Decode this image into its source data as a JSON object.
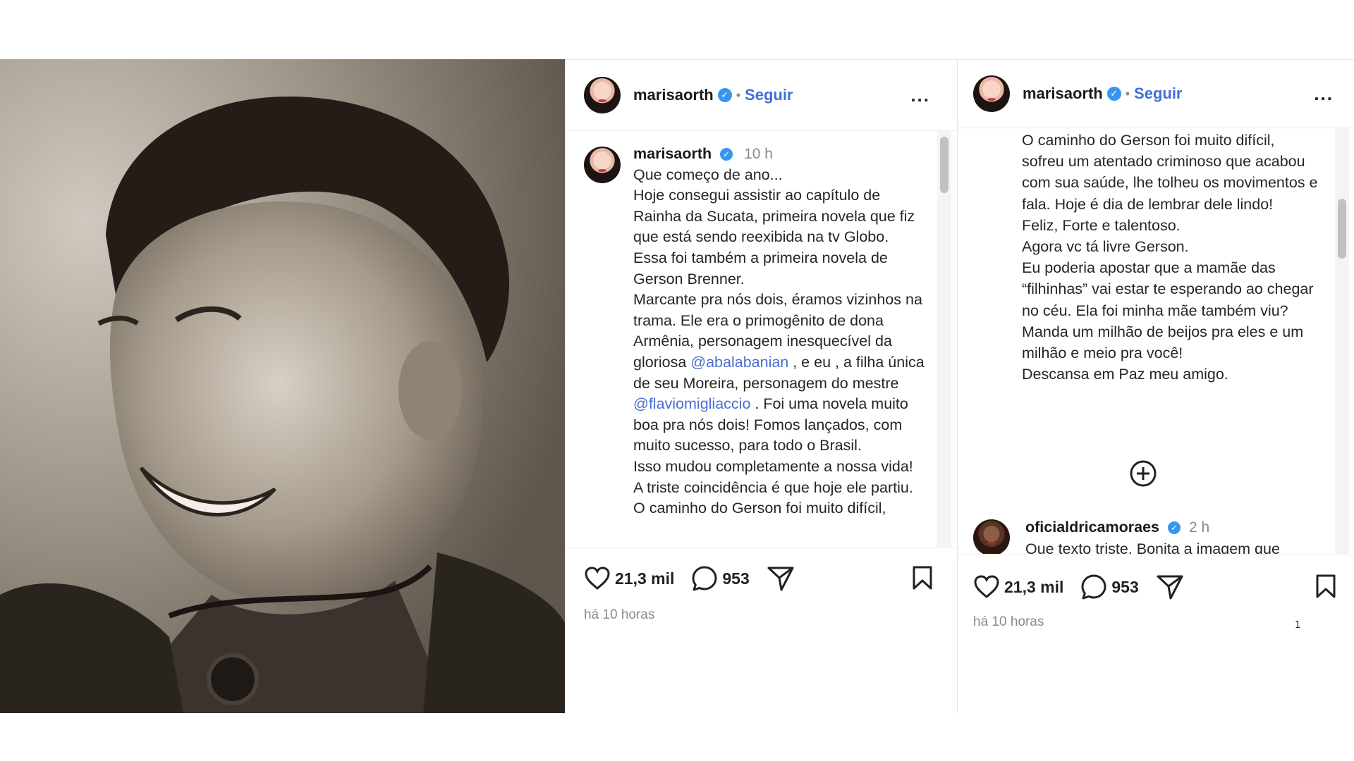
{
  "colors": {
    "link": "#3f6fd8",
    "mention": "#4b6fd0",
    "verified": "#3796f0",
    "muted": "#8a8a8a"
  },
  "panel1": {
    "header": {
      "username": "marisaorth",
      "separator": "•",
      "follow_label": "Seguir",
      "more_icon": "..."
    },
    "caption": {
      "username": "marisaorth",
      "time": "10 h",
      "text_1": "Que começo de ano...\nHoje consegui assistir ao capítulo de Rainha da Sucata, primeira novela que fiz que está sendo reexibida na tv Globo.\nEssa foi também a primeira novela de Gerson Brenner.\nMarcante pra nós dois, éramos vizinhos na trama. Ele era o primogênito de dona Armênia, personagem inesquecível da gloriosa ",
      "mention_1": "@abalabanian",
      "text_2": " , e eu , a filha única de seu Moreira, personagem do mestre ",
      "mention_2": "@flaviomigliaccio",
      "text_3": " . Foi uma novela muito boa pra nós dois! Fomos lançados, com muito sucesso, para todo o Brasil.\nIsso mudou completamente a nossa vida!\nA triste coincidência é que hoje ele partiu.\nO caminho do Gerson foi muito difícil,"
    },
    "actions": {
      "likes": "21,3 mil",
      "comments": "953",
      "timestamp": "há 10 horas"
    }
  },
  "panel2": {
    "header": {
      "username": "marisaorth",
      "separator": "•",
      "follow_label": "Seguir",
      "more_icon": "..."
    },
    "caption_text": "O caminho do Gerson foi muito difícil, sofreu um atentado criminoso que acabou com sua saúde, lhe tolheu os movimentos e fala. Hoje é dia de lembrar dele lindo!\nFeliz, Forte e talentoso.\nAgora vc tá livre Gerson.\nEu poderia apostar que a mamãe das “filhinhas” vai estar te esperando ao chegar no céu. Ela foi minha mãe também viu? Manda um milhão de beijos pra eles e um milhão e meio pra você!\nDescansa  em Paz meu amigo.",
    "comment": {
      "username": "oficialdricamoraes",
      "time": "2 h",
      "text": "Que texto triste. Bonita a imagem que você nos deu dele sendo recebido por Aracy! Muito amor pra família. Gerson Foi um guerreiro"
    },
    "actions": {
      "likes": "21,3 mil",
      "comments": "953",
      "timestamp": "há 10 horas"
    },
    "page_number": "1"
  }
}
